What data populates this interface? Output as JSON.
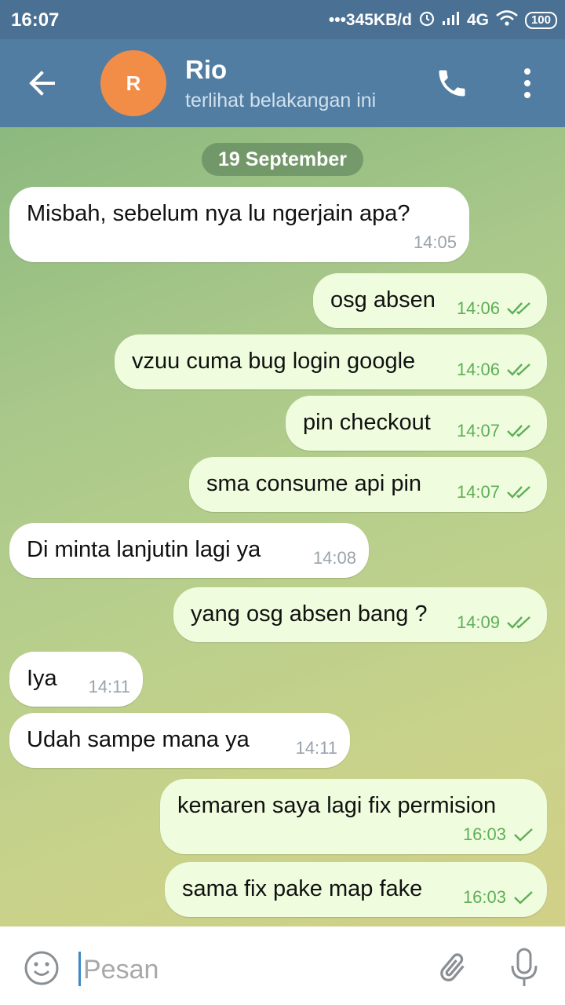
{
  "status_bar": {
    "time": "16:07",
    "network_speed": "345KB/d",
    "network_type": "4G",
    "battery": "100"
  },
  "header": {
    "avatar_initial": "R",
    "name": "Rio",
    "status": "terlihat belakangan ini"
  },
  "chat": {
    "date": "19 September",
    "messages": [
      {
        "direction": "in",
        "text": "Misbah, sebelum nya lu ngerjain apa?",
        "time": "14:05"
      },
      {
        "direction": "out",
        "text": "osg absen",
        "time": "14:06",
        "ticks": "double"
      },
      {
        "direction": "out",
        "text": "vzuu cuma bug login google",
        "time": "14:06",
        "ticks": "double"
      },
      {
        "direction": "out",
        "text": "pin checkout",
        "time": "14:07",
        "ticks": "double"
      },
      {
        "direction": "out",
        "text": "sma consume api pin",
        "time": "14:07",
        "ticks": "double"
      },
      {
        "direction": "in",
        "text": "Di minta lanjutin lagi ya",
        "time": "14:08"
      },
      {
        "direction": "out",
        "text": "yang osg absen bang ?",
        "time": "14:09",
        "ticks": "double"
      },
      {
        "direction": "in",
        "text": "Iya",
        "time": "14:11"
      },
      {
        "direction": "in",
        "text": "Udah sampe mana ya",
        "time": "14:11"
      },
      {
        "direction": "out",
        "text": "kemaren saya lagi fix permision",
        "time": "16:03",
        "ticks": "single"
      },
      {
        "direction": "out",
        "text": "sama fix pake map fake",
        "time": "16:03",
        "ticks": "single"
      }
    ]
  },
  "composer": {
    "placeholder": "Pesan"
  },
  "colors": {
    "header": "#517da2",
    "status_bar": "#4a7193",
    "avatar": "#f28d47",
    "outgoing_bubble": "#effdde",
    "tick": "#5fae58"
  }
}
